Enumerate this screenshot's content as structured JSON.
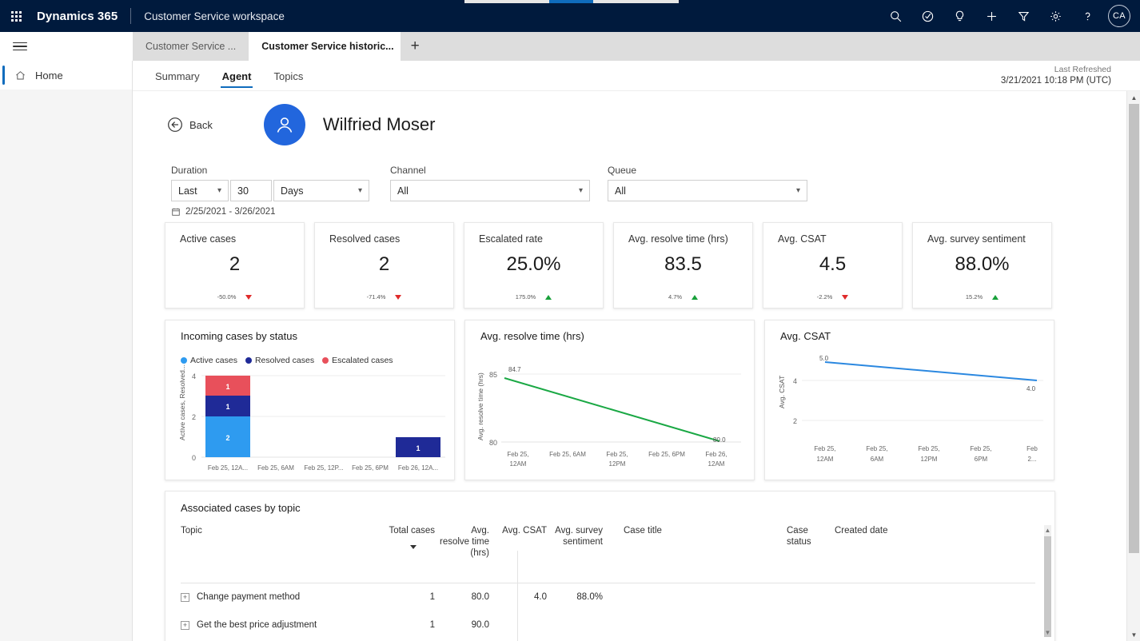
{
  "header": {
    "brand": "Dynamics 365",
    "app_name": "Customer Service workspace",
    "icons": [
      "search-icon",
      "assistant-icon",
      "lightbulb-icon",
      "add-icon",
      "filter-icon",
      "settings-icon",
      "help-icon"
    ],
    "avatar_initials": "CA"
  },
  "tabs": [
    {
      "label": "Customer Service ...",
      "active": false
    },
    {
      "label": "Customer Service historic...",
      "active": true
    }
  ],
  "new_tab_label": "+",
  "tab_close_label": "✕",
  "sidebar": {
    "items": [
      {
        "label": "Home",
        "icon": "home-icon",
        "active": true
      }
    ]
  },
  "subtabs": [
    {
      "label": "Summary",
      "active": false
    },
    {
      "label": "Agent",
      "active": true
    },
    {
      "label": "Topics",
      "active": false
    }
  ],
  "refresh": {
    "label": "Last Refreshed",
    "value": "3/21/2021 10:18 PM (UTC)"
  },
  "agent": {
    "back_label": "Back",
    "name": "Wilfried Moser",
    "avatar_icon": "person-icon"
  },
  "filters": {
    "duration": {
      "label": "Duration",
      "relative": "Last",
      "amount": "30",
      "unit": "Days",
      "range_text": "2/25/2021 - 3/26/2021"
    },
    "channel": {
      "label": "Channel",
      "value": "All"
    },
    "queue": {
      "label": "Queue",
      "value": "All"
    }
  },
  "kpis": [
    {
      "title": "Active cases",
      "value": "2",
      "delta": "-50.0%",
      "direction": "down"
    },
    {
      "title": "Resolved cases",
      "value": "2",
      "delta": "-71.4%",
      "direction": "down"
    },
    {
      "title": "Escalated rate",
      "value": "25.0%",
      "delta": "175.0%",
      "direction": "up"
    },
    {
      "title": "Avg. resolve time (hrs)",
      "value": "83.5",
      "delta": "4.7%",
      "direction": "up"
    },
    {
      "title": "Avg. CSAT",
      "value": "4.5",
      "delta": "-2.2%",
      "direction": "down"
    },
    {
      "title": "Avg. survey sentiment",
      "value": "88.0%",
      "delta": "15.2%",
      "direction": "up"
    }
  ],
  "colors": {
    "brand_navy": "#001a3d",
    "accent_blue": "#0f6cbd",
    "active_cases": "#2e9bf0",
    "resolved_cases": "#1f2a97",
    "escalated_cases": "#e8505b",
    "line_green": "#1aa844",
    "line_blue": "#2b88e0",
    "up_green": "#18a03a",
    "down_red": "#e02b2b"
  },
  "chart_data": [
    {
      "type": "bar",
      "title": "Incoming cases by status",
      "stacked": true,
      "xlabel": "",
      "ylabel": "Active cases, Resolved...",
      "ylim": [
        0,
        4
      ],
      "yticks": [
        "0",
        "2",
        "4"
      ],
      "grid": true,
      "legend_position": "top",
      "categories": [
        "Feb 25, 12A...",
        "Feb 25, 6AM",
        "Feb 25, 12P...",
        "Feb 25, 6PM",
        "Feb 26, 12A..."
      ],
      "series": [
        {
          "name": "Active cases",
          "color": "#2e9bf0",
          "values": [
            2,
            0,
            0,
            0,
            0
          ]
        },
        {
          "name": "Resolved cases",
          "color": "#1f2a97",
          "values": [
            1,
            0,
            0,
            0,
            1
          ]
        },
        {
          "name": "Escalated cases",
          "color": "#e8505b",
          "values": [
            1,
            0,
            0,
            0,
            0
          ]
        }
      ]
    },
    {
      "type": "line",
      "title": "Avg. resolve time (hrs)",
      "xlabel": "",
      "ylabel": "Avg. resolve time (hrs)",
      "ylim": [
        80,
        85
      ],
      "yticks": [
        "80",
        "85"
      ],
      "grid": true,
      "categories": [
        "Feb 25, 12AM",
        "Feb 25, 6AM",
        "Feb 25, 12PM",
        "Feb 25, 6PM",
        "Feb 26, 12AM"
      ],
      "series": [
        {
          "name": "Avg. resolve time (hrs)",
          "color": "#1aa844",
          "x": [
            "Feb 25, 12AM",
            "Feb 26, 12AM"
          ],
          "values": [
            84.7,
            80.0
          ]
        }
      ],
      "point_labels": [
        "84.7",
        "80.0"
      ]
    },
    {
      "type": "line",
      "title": "Avg. CSAT",
      "xlabel": "",
      "ylabel": "Avg. CSAT",
      "ylim": [
        0,
        5.5
      ],
      "yticks": [
        "2",
        "4"
      ],
      "grid": true,
      "categories": [
        "Feb 25, 12AM",
        "Feb 25, 6AM",
        "Feb 25, 12PM",
        "Feb 25, 6PM",
        "Feb 2..."
      ],
      "series": [
        {
          "name": "Avg. CSAT",
          "color": "#2b88e0",
          "x": [
            "Feb 25, 12AM",
            "Feb 2..."
          ],
          "values": [
            5.0,
            4.0
          ]
        }
      ],
      "point_labels": [
        "5.0",
        "4.0"
      ]
    }
  ],
  "table": {
    "title": "Associated cases by topic",
    "sorted_column": "Total cases",
    "columns": [
      "Topic",
      "Total cases",
      "Avg. resolve time (hrs)",
      "Avg. CSAT",
      "Avg. survey sentiment",
      "Case title",
      "Case status",
      "Created date"
    ],
    "rows": [
      {
        "topic": "Change payment method",
        "total_cases": "1",
        "avg_resolve_time": "80.0",
        "avg_csat": "4.0",
        "avg_survey_sentiment": "88.0%",
        "case_title": "",
        "case_status": "",
        "created_date": ""
      },
      {
        "topic": "Get the best price adjustment",
        "total_cases": "1",
        "avg_resolve_time": "90.0",
        "avg_csat": "",
        "avg_survey_sentiment": "",
        "case_title": "",
        "case_status": "",
        "created_date": ""
      }
    ],
    "expand_glyph": "+"
  },
  "scroll": {
    "up_glyph": "▲",
    "down_glyph": "▼"
  }
}
